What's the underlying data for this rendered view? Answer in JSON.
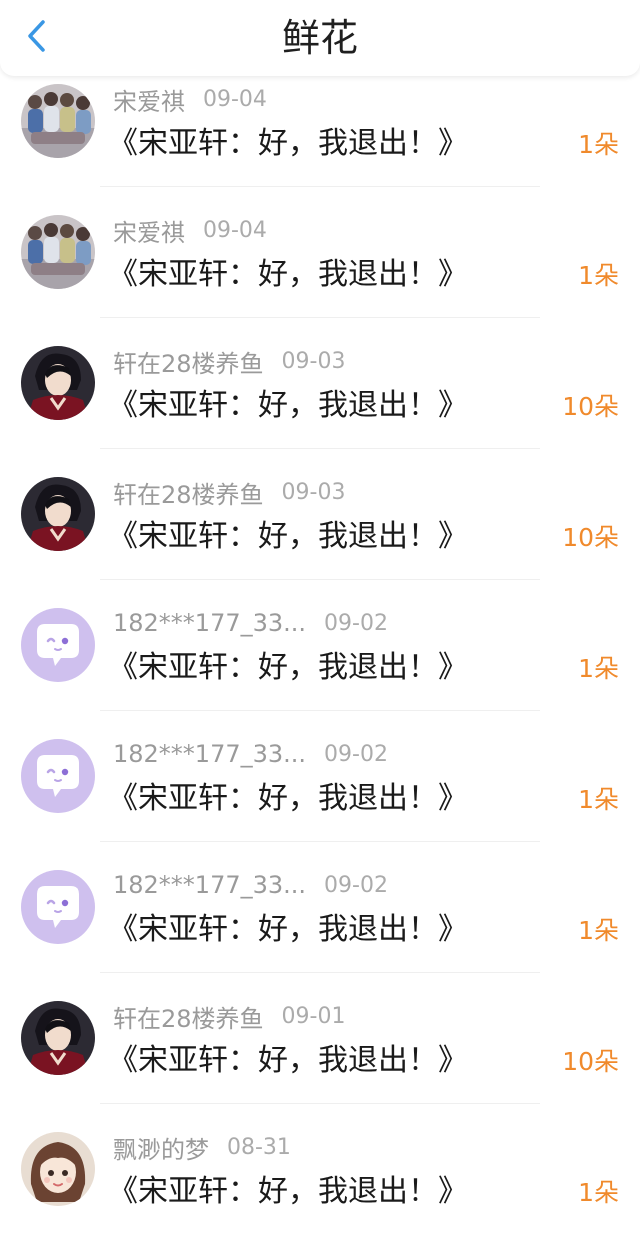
{
  "header": {
    "title": "鲜花",
    "back_icon": "back-chevron-icon",
    "accent": "#3a97e4"
  },
  "colors": {
    "count": "#f08a2c",
    "name": "#9a9a9a",
    "title": "#1a1a1a"
  },
  "items": [
    {
      "avatar": "group-photo-avatar",
      "name": "宋爱祺",
      "date": "09-04",
      "work": "《宋亚轩：好，我退出！》",
      "count": "1朵"
    },
    {
      "avatar": "group-photo-avatar",
      "name": "宋爱祺",
      "date": "09-04",
      "work": "《宋亚轩：好，我退出！》",
      "count": "1朵"
    },
    {
      "avatar": "portrait-avatar",
      "name": "轩在28楼养鱼",
      "date": "09-03",
      "work": "《宋亚轩：好，我退出！》",
      "count": "10朵"
    },
    {
      "avatar": "portrait-avatar",
      "name": "轩在28楼养鱼",
      "date": "09-03",
      "work": "《宋亚轩：好，我退出！》",
      "count": "10朵"
    },
    {
      "avatar": "chat-bubble-avatar",
      "name": "182***177_33...",
      "date": "09-02",
      "work": "《宋亚轩：好，我退出！》",
      "count": "1朵"
    },
    {
      "avatar": "chat-bubble-avatar",
      "name": "182***177_33...",
      "date": "09-02",
      "work": "《宋亚轩：好，我退出！》",
      "count": "1朵"
    },
    {
      "avatar": "chat-bubble-avatar",
      "name": "182***177_33...",
      "date": "09-02",
      "work": "《宋亚轩：好，我退出！》",
      "count": "1朵"
    },
    {
      "avatar": "portrait-avatar",
      "name": "轩在28楼养鱼",
      "date": "09-01",
      "work": "《宋亚轩：好，我退出！》",
      "count": "10朵"
    },
    {
      "avatar": "cartoon-girl-avatar",
      "name": "飘渺的梦",
      "date": "08-31",
      "work": "《宋亚轩：好，我退出！》",
      "count": "1朵"
    }
  ]
}
